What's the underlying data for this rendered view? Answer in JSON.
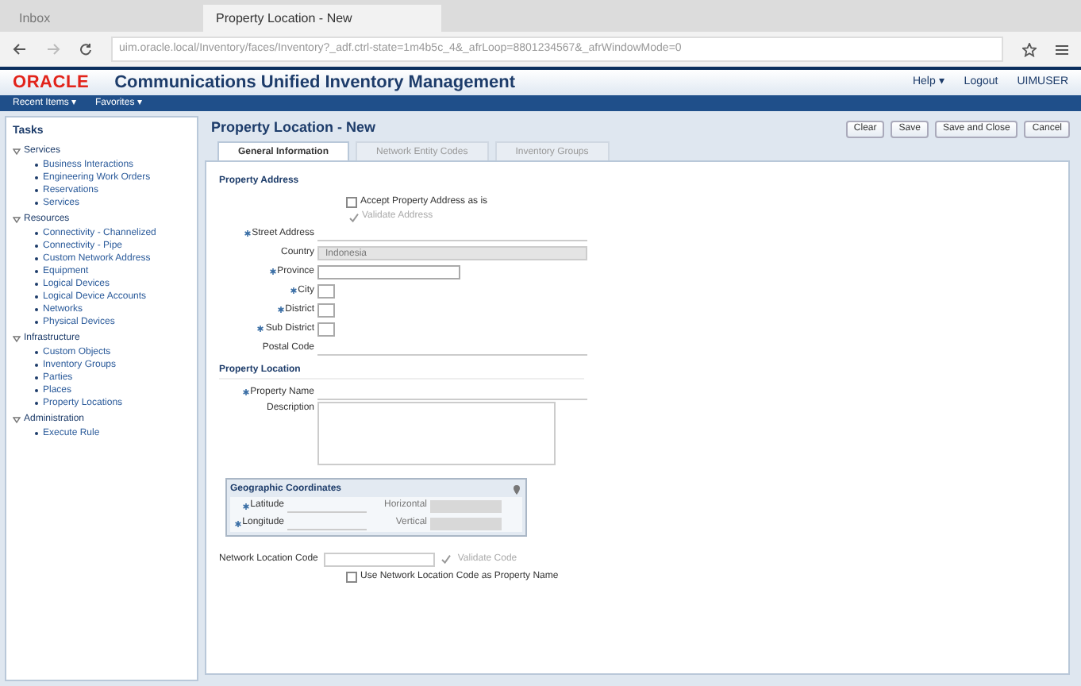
{
  "browser": {
    "tabs": [
      {
        "label": "Inbox",
        "selected": false
      },
      {
        "label": "Property Location - New",
        "selected": true
      }
    ],
    "url": "uim.oracle.local/Inventory/faces/Inventory?_adf.ctrl-state=1m4b5c_4&_afrLoop=8801234567&_afrWindowMode=0"
  },
  "app": {
    "logo": "ORACLE",
    "title": "Communications Unified Inventory Management",
    "header_links": [
      "Help ▾",
      "Logout",
      "UIMUSER"
    ],
    "nav": [
      "Recent Items ▾",
      "Favorites ▾"
    ]
  },
  "tasks": {
    "title": "Tasks",
    "groups": [
      {
        "label": "Services",
        "expanded": true,
        "children": [
          "Business Interactions",
          "Engineering Work Orders",
          "Reservations",
          "Services"
        ]
      },
      {
        "label": "Resources",
        "expanded": true,
        "children": [
          "Connectivity - Channelized",
          "Connectivity - Pipe",
          "Custom Network Address",
          "Equipment",
          "Logical Devices",
          "Logical Device Accounts",
          "Networks",
          "Physical Devices"
        ]
      },
      {
        "label": "Infrastructure",
        "expanded": true,
        "children": [
          "Custom Objects",
          "Inventory Groups",
          "Parties",
          "Places",
          "Property Locations"
        ]
      },
      {
        "label": "Administration",
        "expanded": true,
        "children": [
          "Execute Rule"
        ]
      }
    ]
  },
  "page": {
    "title": "Property Location - New",
    "buttons": [
      "Clear",
      "Save",
      "Save and Close",
      "Cancel"
    ],
    "tabs": [
      {
        "label": "General Information",
        "selected": true
      },
      {
        "label": "Network Entity Codes",
        "selected": false
      },
      {
        "label": "Inventory Groups",
        "selected": false
      }
    ],
    "address": {
      "heading": "Property Address",
      "accept_label": "Accept Property Address as is",
      "accept_checked": false,
      "validate": "Validate Address",
      "fields": [
        {
          "label": "Street Address",
          "required": true,
          "kind": "text"
        },
        {
          "label": "Country",
          "required": false,
          "kind": "readonly",
          "value": "Indonesia"
        },
        {
          "label": "Province",
          "required": true,
          "kind": "select"
        },
        {
          "label": "City",
          "required": true,
          "kind": "small"
        },
        {
          "label": "District",
          "required": true,
          "kind": "small"
        },
        {
          "label": "Sub District",
          "required": true,
          "kind": "small"
        },
        {
          "label": "Postal Code",
          "required": false,
          "kind": "text"
        }
      ]
    },
    "location": {
      "heading": "Property Location",
      "name_label": "Property Name",
      "description_label": "Description"
    },
    "geo": {
      "heading": "Geographic Coordinates",
      "latitude": "Latitude",
      "longitude": "Longitude",
      "horizontal": "Horizontal",
      "vertical": "Vertical"
    },
    "network": {
      "label": "Network Location Code",
      "validate": "Validate Code",
      "use_label": "Use Network Location Code as Property Name",
      "use_checked": false
    }
  }
}
